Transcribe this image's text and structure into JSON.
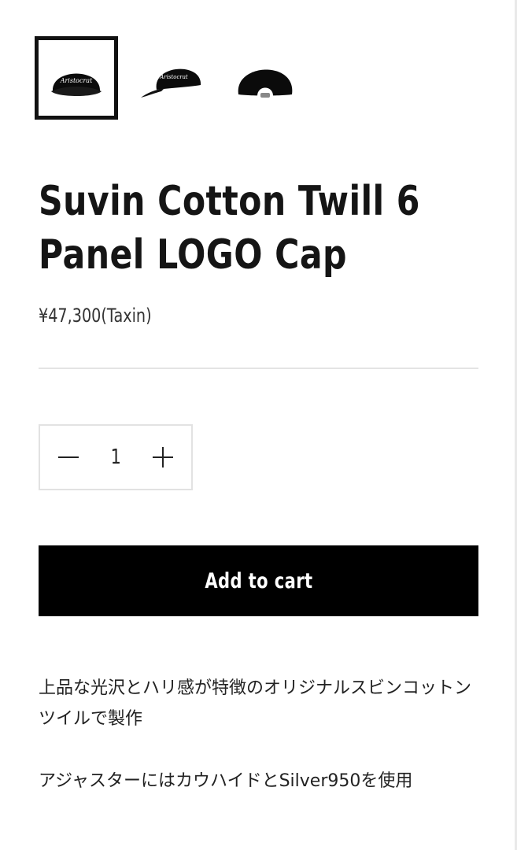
{
  "gallery": {
    "thumbnails": [
      {
        "alt": "cap-front-view",
        "selected": true
      },
      {
        "alt": "cap-side-view",
        "selected": false
      },
      {
        "alt": "cap-back-view",
        "selected": false
      }
    ],
    "logo_text": "Aristocrat"
  },
  "product": {
    "title_line1": "Suvin Cotton Twill 6",
    "title_line2": "Panel LOGO Cap",
    "price": "¥47,300(Taxin)"
  },
  "quantity": {
    "value": "1"
  },
  "cart": {
    "add_label": "Add to cart"
  },
  "description": {
    "paragraph1": "上品な光沢とハリ感が特徴のオリジナルスビンコットンツイルで製作",
    "paragraph2": "アジャスターにはカウハイドとSilver950を使用"
  },
  "colors": {
    "button_bg": "#000000",
    "button_text": "#ffffff",
    "border": "#e2e2e2"
  }
}
